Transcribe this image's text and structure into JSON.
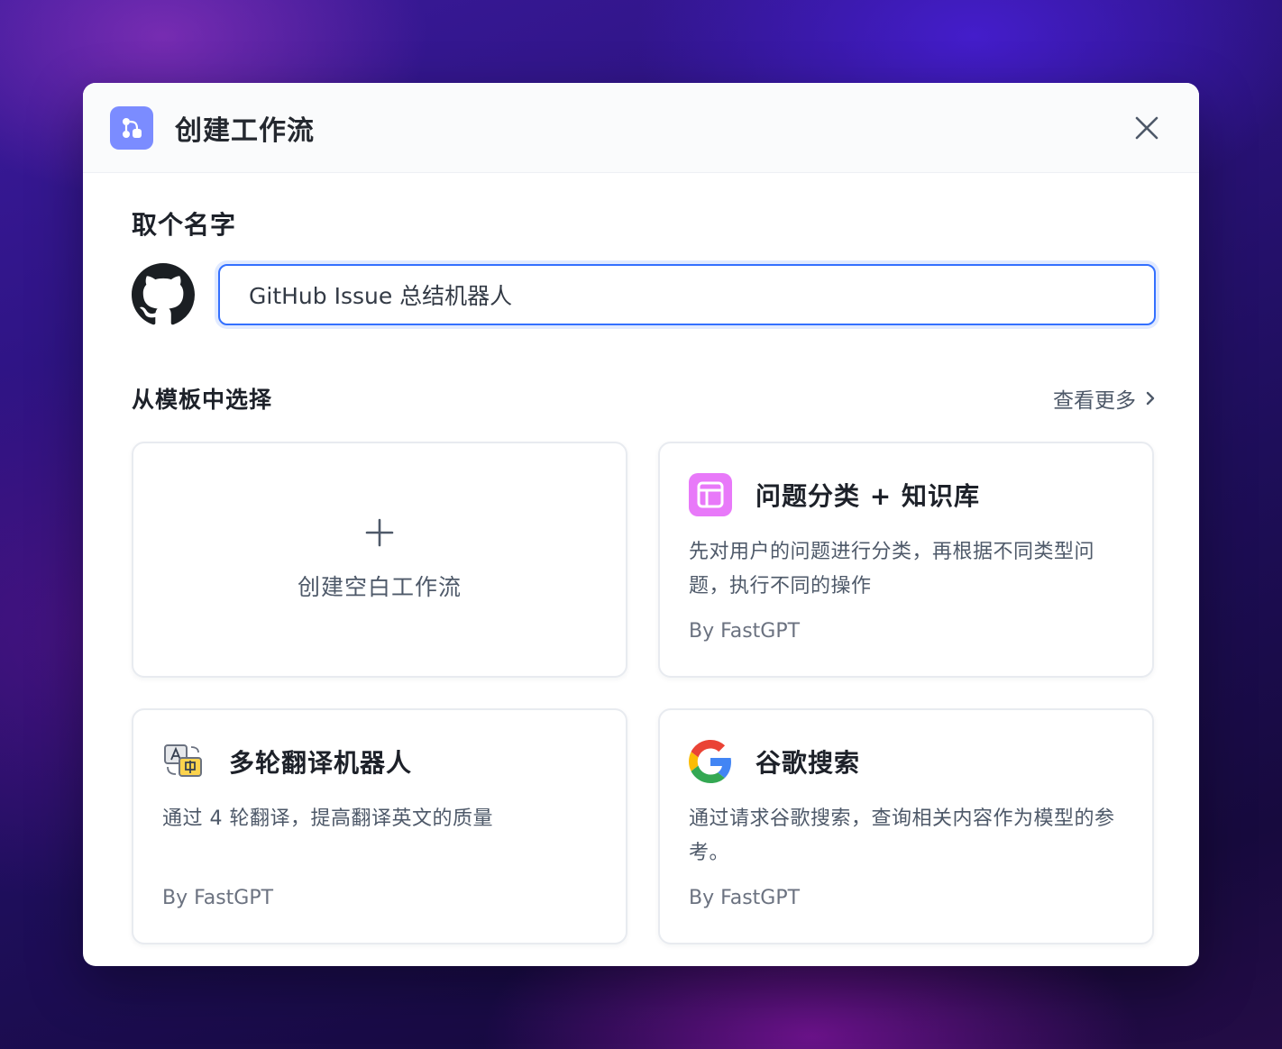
{
  "dialog": {
    "title": "创建工作流",
    "close_icon": "close-icon",
    "header_icon": "workflow-icon"
  },
  "name_section": {
    "label": "取个名字",
    "avatar_icon": "github-icon",
    "input_value": "GitHub Issue 总结机器人"
  },
  "templates": {
    "label": "从模板中选择",
    "see_more": "查看更多",
    "blank": {
      "label": "创建空白工作流",
      "icon": "plus-icon"
    },
    "items": [
      {
        "title": "问题分类 + 知识库",
        "description": "先对用户的问题进行分类，再根据不同类型问题，执行不同的操作",
        "author": "By FastGPT",
        "icon": "layout-icon",
        "icon_color": "#e879f9"
      },
      {
        "title": "多轮翻译机器人",
        "description": "通过 4 轮翻译，提高翻译英文的质量",
        "author": "By FastGPT",
        "icon": "translate-icon"
      },
      {
        "title": "谷歌搜索",
        "description": "通过请求谷歌搜索，查询相关内容作为模型的参考。",
        "author": "By FastGPT",
        "icon": "google-icon"
      }
    ]
  },
  "colors": {
    "accent": "#3370ff",
    "header_icon_bg": "#7b8cff"
  }
}
